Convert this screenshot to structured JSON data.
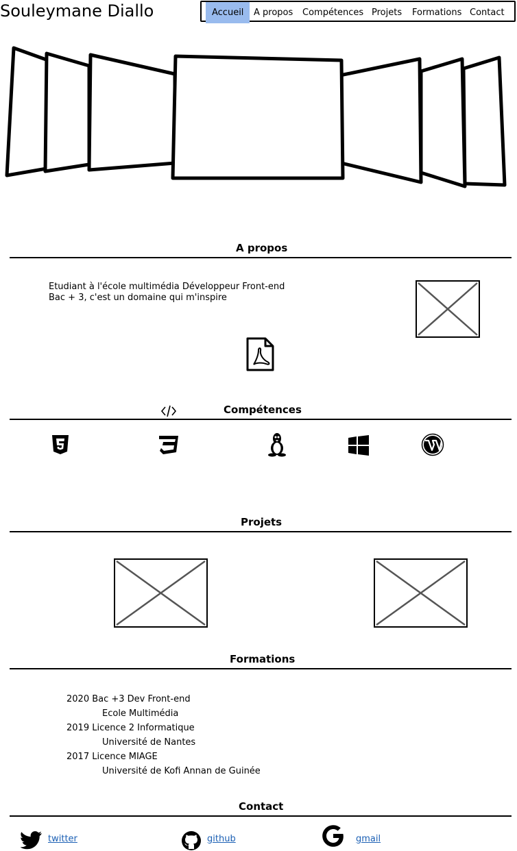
{
  "header": {
    "title": "Souleymane Diallo",
    "nav": [
      "Accueil",
      "A propos",
      "Compétences",
      "Projets",
      "Formations",
      "Contact"
    ]
  },
  "about": {
    "heading": "A propos",
    "line1": "Etudiant à l'école multimédia Développeur Front-end",
    "line2": "Bac + 3, c'est un domaine qui m'inspire"
  },
  "skills": {
    "heading": "Compétences"
  },
  "projects": {
    "heading": "Projets"
  },
  "education": {
    "heading": "Formations",
    "entries": [
      {
        "title": "2020 Bac +3 Dev Front-end",
        "school": "Ecole Multimédia"
      },
      {
        "title": "2019 Licence 2 Informatique",
        "school": "Université de Nantes"
      },
      {
        "title": "2017 Licence MIAGE",
        "school": "Université de Kofi Annan de Guinée"
      }
    ]
  },
  "contact": {
    "heading": "Contact",
    "links": [
      "twitter",
      "github",
      "gmail"
    ],
    "link_color": "#1a5fb4"
  },
  "colors": {
    "active_nav": "#99bbee"
  }
}
